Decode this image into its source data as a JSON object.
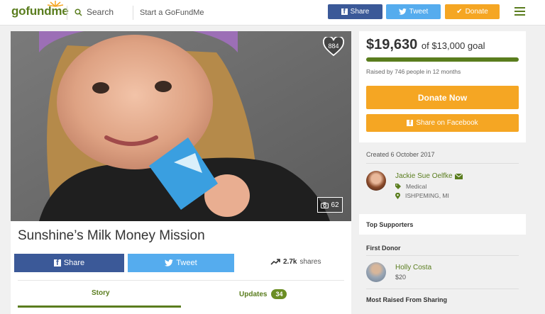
{
  "header": {
    "logo": "gofundme",
    "search_label": "Search",
    "start_label": "Start a GoFundMe",
    "share_label": "Share",
    "tweet_label": "Tweet",
    "donate_label": "Donate"
  },
  "hero": {
    "likes": "884",
    "photo_count": "62"
  },
  "campaign": {
    "title": "Sunshine’s Milk Money Mission",
    "share_label": "Share",
    "tweet_label": "Tweet",
    "shares_count": "2.7k",
    "shares_label": "shares",
    "tabs": {
      "story": "Story",
      "updates": "Updates",
      "updates_count": "34"
    }
  },
  "donation": {
    "raised": "$19,630",
    "goal_text": "of $13,000 goal",
    "progress_percent": 100,
    "raised_by": "Raised by 746 people in 12 months",
    "donate_now": "Donate Now",
    "share_facebook": "Share on Facebook"
  },
  "organizer": {
    "created": "Created 6 October 2017",
    "name": "Jackie Sue Oelfke",
    "category": "Medical",
    "location": "ISHPEMING, MI"
  },
  "supporters": {
    "title": "Top Supporters",
    "first_donor_label": "First Donor",
    "first_donor_name": "Holly Costa",
    "first_donor_amount": "$20",
    "most_raised_label": "Most Raised From Sharing"
  },
  "colors": {
    "brand_green": "#5a7d1e",
    "facebook": "#3b5998",
    "twitter": "#55acee",
    "donate_orange": "#f5a623"
  }
}
